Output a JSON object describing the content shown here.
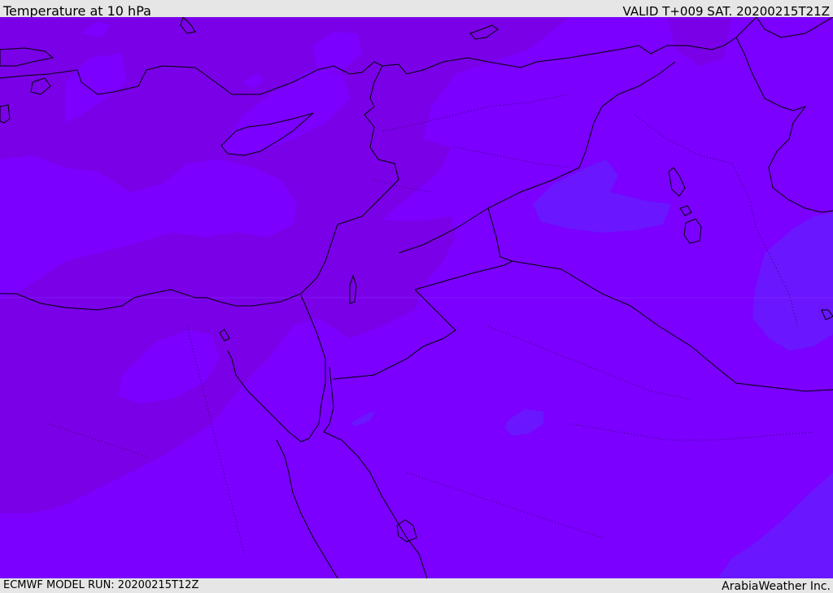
{
  "header": {
    "title": "Temperature at 10 hPa",
    "valid": "VALID T+009 SAT. 20200215T21Z"
  },
  "footer": {
    "model_run": "ECMWF MODEL RUN: 20200215T12Z",
    "credit": "ArabiaWeather Inc."
  },
  "colors": {
    "warm_band": "#7a00e8",
    "mid_band": "#7b00ff",
    "cool_band": "#6a16ff",
    "coastline": "#000000"
  }
}
